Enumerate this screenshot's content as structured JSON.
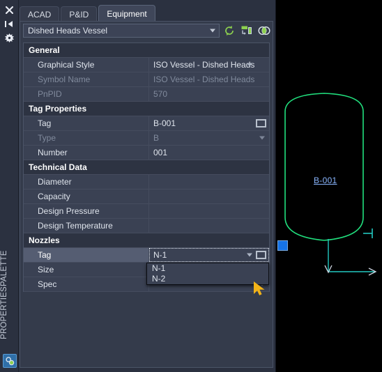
{
  "window": {
    "strip_title": "PROPERTIESPALETTE",
    "strip_icons": [
      {
        "name": "close-icon",
        "label": "Close"
      },
      {
        "name": "auto-hide-icon",
        "label": "Auto-hide"
      },
      {
        "name": "properties-menu-icon",
        "label": "Properties"
      }
    ],
    "bottom_icon_label": "palette-options-icon"
  },
  "tabs": [
    {
      "label": "ACAD",
      "active": false
    },
    {
      "label": "P&ID",
      "active": false
    },
    {
      "label": "Equipment",
      "active": true
    }
  ],
  "selector": {
    "value": "Dished Heads Vessel",
    "caret": "chevron-down-icon",
    "tools": [
      {
        "name": "refresh-icon",
        "label": "Refresh"
      },
      {
        "name": "quick-properties-icon",
        "label": "Quick Properties"
      },
      {
        "name": "overlap-circles-icon",
        "label": "Select Similar"
      }
    ]
  },
  "groups": [
    {
      "title": "General",
      "rows": [
        {
          "label": "Graphical Style",
          "value": "ISO Vessel - Dished Heads",
          "dim": false,
          "caret": true,
          "browse": false,
          "selected": false
        },
        {
          "label": "Symbol Name",
          "value": "ISO Vessel - Dished Heads",
          "dim": true,
          "caret": false,
          "browse": false,
          "selected": false
        },
        {
          "label": "PnPID",
          "value": "570",
          "dim": true,
          "caret": false,
          "browse": false,
          "selected": false
        }
      ]
    },
    {
      "title": "Tag Properties",
      "rows": [
        {
          "label": "Tag",
          "value": "B-001",
          "dim": false,
          "caret": false,
          "browse": true,
          "selected": false
        },
        {
          "label": "Type",
          "value": "B",
          "dim": true,
          "caret": true,
          "caret_noedit": true,
          "browse": false,
          "selected": false
        },
        {
          "label": "Number",
          "value": "001",
          "dim": false,
          "caret": false,
          "browse": false,
          "selected": false
        }
      ]
    },
    {
      "title": "Technical Data",
      "rows": [
        {
          "label": "Diameter",
          "value": "",
          "dim": false,
          "caret": false,
          "browse": false,
          "selected": false
        },
        {
          "label": "Capacity",
          "value": "",
          "dim": false,
          "caret": false,
          "browse": false,
          "selected": false
        },
        {
          "label": "Design Pressure",
          "value": "",
          "dim": false,
          "caret": false,
          "browse": false,
          "selected": false
        },
        {
          "label": "Design Temperature",
          "value": "",
          "dim": false,
          "caret": false,
          "browse": false,
          "selected": false
        }
      ]
    },
    {
      "title": "Nozzles",
      "rows": [
        {
          "label": "Tag",
          "value": "N-1",
          "dim": false,
          "caret": true,
          "browse": true,
          "selected": true,
          "focused": true
        },
        {
          "label": "Size",
          "value": "",
          "dim": false,
          "caret": false,
          "browse": false,
          "selected": false
        },
        {
          "label": "Spec",
          "value": "",
          "dim": false,
          "caret": true,
          "caret_noedit": true,
          "browse": false,
          "selected": false
        }
      ]
    }
  ],
  "nozzle_dropdown": {
    "open": true,
    "options": [
      "N-1",
      "N-2"
    ],
    "selected": "N-1"
  },
  "drawing": {
    "equipment_label": "B-001",
    "outline_color": "#21e07e",
    "nozzle_color": "#23c9c1",
    "label_color": "#8ab6ff",
    "grip_color": "#1673e6",
    "background": "#000000"
  },
  "cursor": {
    "name": "pick-arrow-cursor",
    "color": "#f2b318"
  }
}
